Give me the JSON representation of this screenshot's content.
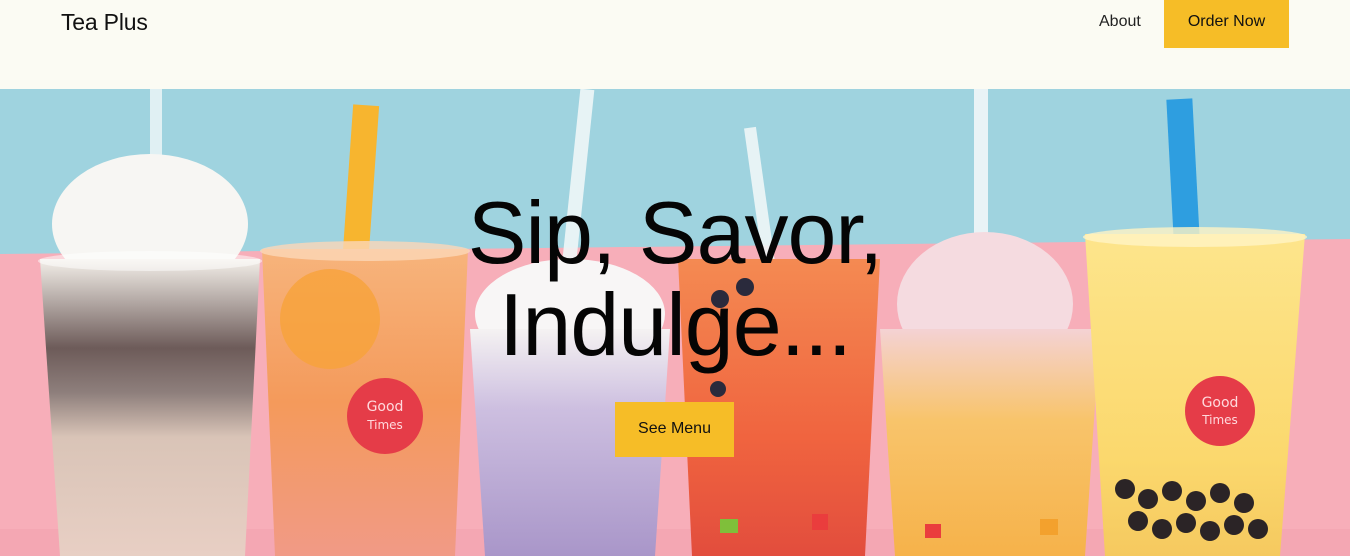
{
  "header": {
    "brand": "Tea Plus",
    "nav": {
      "about_label": "About",
      "order_label": "Order Now"
    }
  },
  "hero": {
    "title_line1": "Sip, Savor,",
    "title_line2": "Indulge...",
    "cta_label": "See Menu",
    "image": {
      "icon": "bubble-tea-cups-photo",
      "cup_stickers": [
        "Good Times",
        "Good Times"
      ]
    }
  },
  "colors": {
    "page_background": "#fbfbf3",
    "accent_yellow": "#f6bd27",
    "hero_blue": "#9fd3df",
    "hero_pink": "#f7aeb9",
    "text_dark": "#050505"
  }
}
